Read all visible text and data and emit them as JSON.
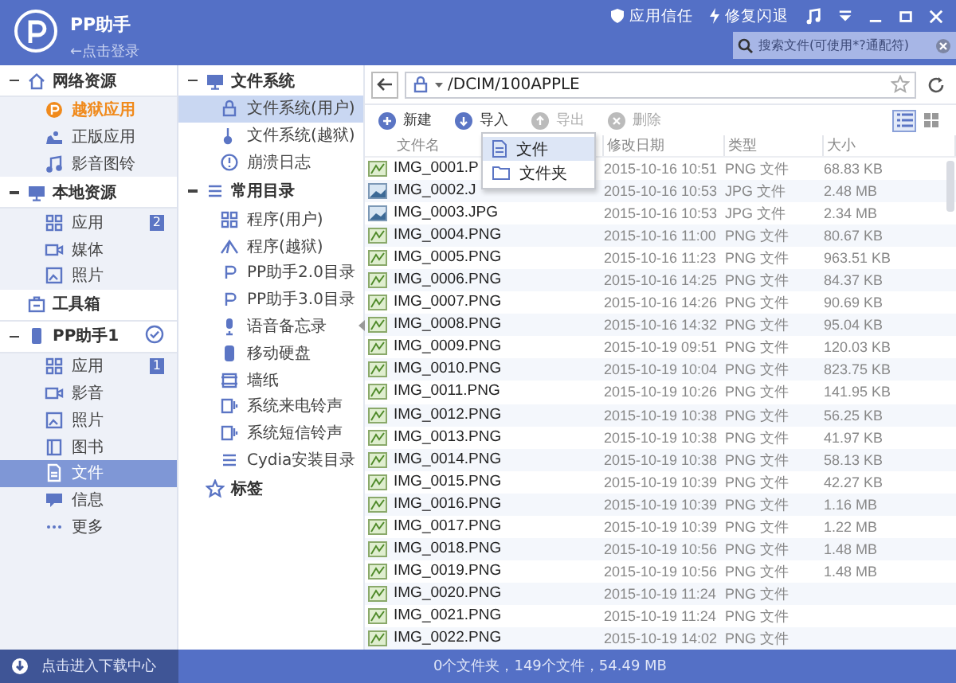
{
  "header": {
    "app_name": "PP助手",
    "login": "←点击登录",
    "actions": [
      {
        "label": "应用信任"
      },
      {
        "label": "修复闪退"
      }
    ],
    "search": {
      "placeholder": "搜索文件(可使用*?通配符)"
    }
  },
  "sidebar": {
    "groups": [
      {
        "label": "网络资源",
        "expanded": true,
        "items": [
          {
            "label": "越狱应用",
            "accent": true,
            "selected": false
          },
          {
            "label": "正版应用",
            "accent": false,
            "selected": false
          },
          {
            "label": "影音图铃",
            "accent": false,
            "selected": false
          }
        ]
      },
      {
        "label": "本地资源",
        "expanded": true,
        "items": [
          {
            "label": "应用",
            "badge": "2",
            "selected": false
          },
          {
            "label": "媒体",
            "selected": false
          },
          {
            "label": "照片",
            "selected": false
          }
        ]
      },
      {
        "label": "工具箱"
      },
      {
        "label": "PP助手1",
        "expanded": true,
        "connected": true,
        "items": [
          {
            "label": "应用",
            "badge": "1",
            "selected": false
          },
          {
            "label": "影音",
            "selected": false
          },
          {
            "label": "照片",
            "selected": false
          },
          {
            "label": "图书",
            "selected": false
          },
          {
            "label": "文件",
            "selected": true
          },
          {
            "label": "信息",
            "selected": false
          },
          {
            "label": "更多",
            "selected": false
          }
        ]
      }
    ]
  },
  "folder_tree": {
    "groups": [
      {
        "label": "文件系统",
        "expanded": true,
        "items": [
          {
            "label": "文件系统(用户)",
            "selected": true
          },
          {
            "label": "文件系统(越狱)",
            "selected": false
          },
          {
            "label": "崩溃日志",
            "selected": false
          }
        ]
      },
      {
        "label": "常用目录",
        "expanded": true,
        "items": [
          {
            "label": "程序(用户)",
            "selected": false
          },
          {
            "label": "程序(越狱)",
            "selected": false
          },
          {
            "label": "PP助手2.0目录",
            "selected": false
          },
          {
            "label": "PP助手3.0目录",
            "selected": false
          },
          {
            "label": "语音备忘录",
            "selected": false
          },
          {
            "label": "移动硬盘",
            "selected": false
          },
          {
            "label": "墙纸",
            "selected": false
          },
          {
            "label": "系统来电铃声",
            "selected": false
          },
          {
            "label": "系统短信铃声",
            "selected": false
          },
          {
            "label": "Cydia安装目录",
            "selected": false
          }
        ]
      },
      {
        "label": "标签"
      }
    ]
  },
  "path_bar": {
    "path": "/DCIM/100APPLE"
  },
  "toolbar": {
    "buttons": [
      {
        "label": "新建",
        "disabled": false
      },
      {
        "label": "导入",
        "disabled": false
      },
      {
        "label": "导出",
        "disabled": true
      },
      {
        "label": "删除",
        "disabled": true
      }
    ],
    "views": [
      {
        "selected": true
      },
      {
        "selected": false
      }
    ]
  },
  "menu": {
    "items": [
      {
        "label": "文件",
        "selected": true
      },
      {
        "label": "文件夹",
        "selected": false
      }
    ]
  },
  "table": {
    "columns": [
      "文件名",
      "修改日期",
      "类型",
      "大小"
    ],
    "rows": [
      {
        "kind": "png",
        "name": "IMG_0001.P",
        "modified": "2015-10-16 10:51",
        "type": "PNG 文件",
        "size": "68.83 KB"
      },
      {
        "kind": "jpg",
        "name": "IMG_0002.J",
        "modified": "2015-10-16 10:53",
        "type": "JPG 文件",
        "size": "2.48 MB"
      },
      {
        "kind": "jpg",
        "name": "IMG_0003.JPG",
        "modified": "2015-10-16 10:53",
        "type": "JPG 文件",
        "size": "2.34 MB"
      },
      {
        "kind": "png",
        "name": "IMG_0004.PNG",
        "modified": "2015-10-16 11:00",
        "type": "PNG 文件",
        "size": "80.67 KB"
      },
      {
        "kind": "png",
        "name": "IMG_0005.PNG",
        "modified": "2015-10-16 11:23",
        "type": "PNG 文件",
        "size": "963.51 KB"
      },
      {
        "kind": "png",
        "name": "IMG_0006.PNG",
        "modified": "2015-10-16 14:25",
        "type": "PNG 文件",
        "size": "84.37 KB"
      },
      {
        "kind": "png",
        "name": "IMG_0007.PNG",
        "modified": "2015-10-16 14:26",
        "type": "PNG 文件",
        "size": "90.69 KB"
      },
      {
        "kind": "png",
        "name": "IMG_0008.PNG",
        "modified": "2015-10-16 14:32",
        "type": "PNG 文件",
        "size": "95.04 KB"
      },
      {
        "kind": "png",
        "name": "IMG_0009.PNG",
        "modified": "2015-10-19 09:51",
        "type": "PNG 文件",
        "size": "120.03 KB"
      },
      {
        "kind": "png",
        "name": "IMG_0010.PNG",
        "modified": "2015-10-19 10:04",
        "type": "PNG 文件",
        "size": "823.75 KB"
      },
      {
        "kind": "png",
        "name": "IMG_0011.PNG",
        "modified": "2015-10-19 10:26",
        "type": "PNG 文件",
        "size": "141.95 KB"
      },
      {
        "kind": "png",
        "name": "IMG_0012.PNG",
        "modified": "2015-10-19 10:38",
        "type": "PNG 文件",
        "size": "56.25 KB"
      },
      {
        "kind": "png",
        "name": "IMG_0013.PNG",
        "modified": "2015-10-19 10:38",
        "type": "PNG 文件",
        "size": "41.97 KB"
      },
      {
        "kind": "png",
        "name": "IMG_0014.PNG",
        "modified": "2015-10-19 10:38",
        "type": "PNG 文件",
        "size": "58.13 KB"
      },
      {
        "kind": "png",
        "name": "IMG_0015.PNG",
        "modified": "2015-10-19 10:39",
        "type": "PNG 文件",
        "size": "42.27 KB"
      },
      {
        "kind": "png",
        "name": "IMG_0016.PNG",
        "modified": "2015-10-19 10:39",
        "type": "PNG 文件",
        "size": "1.16 MB"
      },
      {
        "kind": "png",
        "name": "IMG_0017.PNG",
        "modified": "2015-10-19 10:39",
        "type": "PNG 文件",
        "size": "1.22 MB"
      },
      {
        "kind": "png",
        "name": "IMG_0018.PNG",
        "modified": "2015-10-19 10:56",
        "type": "PNG 文件",
        "size": "1.48 MB"
      },
      {
        "kind": "png",
        "name": "IMG_0019.PNG",
        "modified": "2015-10-19 10:56",
        "type": "PNG 文件",
        "size": "1.48 MB"
      },
      {
        "kind": "png",
        "name": "IMG_0020.PNG",
        "modified": "2015-10-19 11:24",
        "type": "PNG 文件"
      },
      {
        "kind": "png",
        "name": "IMG_0021.PNG",
        "modified": "2015-10-19 11:24",
        "type": "PNG 文件"
      },
      {
        "kind": "png",
        "name": "IMG_0022.PNG",
        "modified": "2015-10-19 14:02",
        "type": "PNG 文件"
      }
    ]
  },
  "status_bar": {
    "download": "点击进入下载中心",
    "summary": "0个文件夹，149个文件，54.49 MB"
  }
}
